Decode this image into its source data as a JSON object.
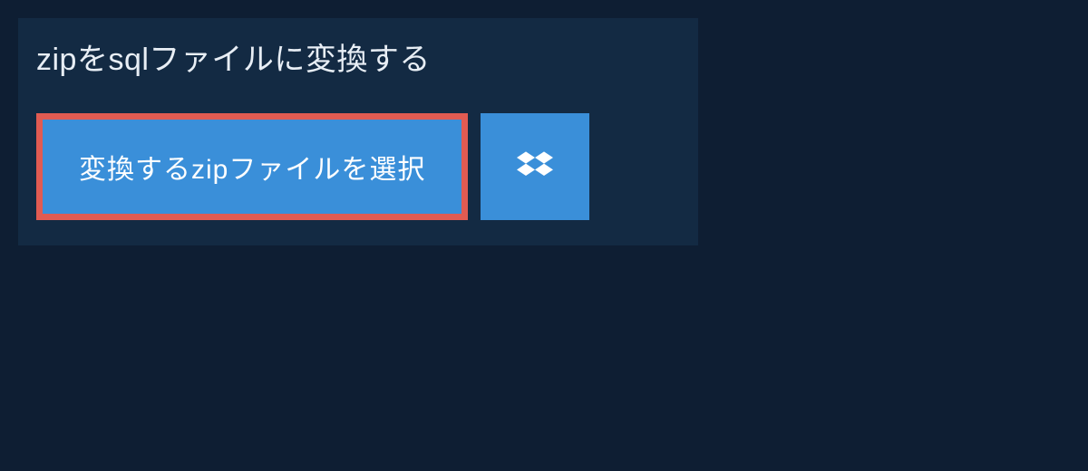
{
  "heading": "zipをsqlファイルに変換する",
  "buttons": {
    "select_file_label": "変換するzipファイルを選択",
    "dropbox_icon": "dropbox"
  },
  "colors": {
    "bg": "#0e1e33",
    "panel": "#132a43",
    "button": "#3a8fd9",
    "highlight_border": "#e15b52",
    "text": "#e8eef5"
  }
}
